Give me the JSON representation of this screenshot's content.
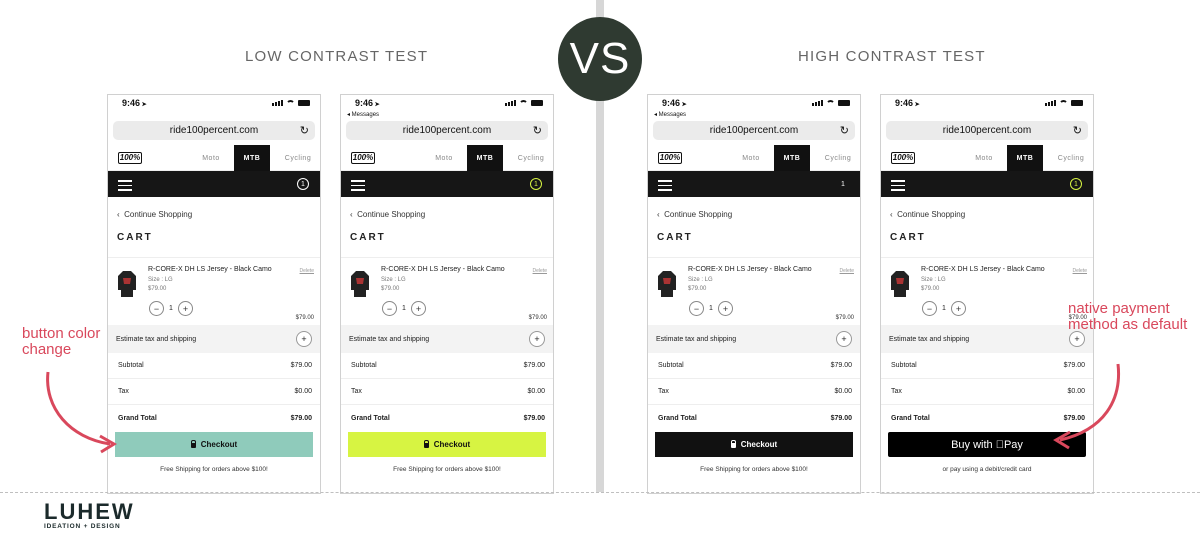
{
  "headings": {
    "low": "LOW CONTRAST TEST",
    "high": "HIGH CONTRAST TEST",
    "vs": "VS"
  },
  "annotations": {
    "button": "button color change",
    "native": "native payment method as default"
  },
  "brand": {
    "name": "LUHEW",
    "tagline": "IDEATION + DESIGN"
  },
  "phone_common": {
    "url": "ride100percent.com",
    "logo": "100%",
    "tabs": [
      "Moto",
      "MTB",
      "Cycling"
    ],
    "continue": "Continue Shopping",
    "cart_title": "CART",
    "item_name": "R-CORE-X DH LS Jersey - Black Camo",
    "item_size": "Size : LG",
    "item_price": "$79.00",
    "delete": "Delete",
    "qty": "1",
    "line_total": "$79.00",
    "estimate": "Estimate tax and shipping",
    "subtotal_label": "Subtotal",
    "subtotal": "$79.00",
    "tax_label": "Tax",
    "tax": "$0.00",
    "grand_label": "Grand Total",
    "grand": "$79.00",
    "checkout": "Checkout",
    "free_shipping": "Free Shipping for orders above $100!",
    "applepay": "Buy with Pay",
    "alt_pay": "or pay using a debit/credit card",
    "cart_count": "1"
  },
  "phones": [
    {
      "time": "9:46",
      "back": "",
      "checkout_color": "#8fcbbb",
      "button": "checkout"
    },
    {
      "time": "9:46",
      "back": "◂ Messages",
      "checkout_color": "#d7f442",
      "button": "checkout"
    },
    {
      "time": "9:46",
      "back": "◂ Messages",
      "checkout_color": "#111111",
      "button": "checkout"
    },
    {
      "time": "9:46",
      "back": "",
      "checkout_color": "#000000",
      "button": "applepay"
    }
  ],
  "colors": {
    "annotation": "#d9485c",
    "vs_circle": "#2f3a31",
    "low_contrast_button": "#8fcbbb",
    "high_contrast_button": "#d7f442"
  }
}
